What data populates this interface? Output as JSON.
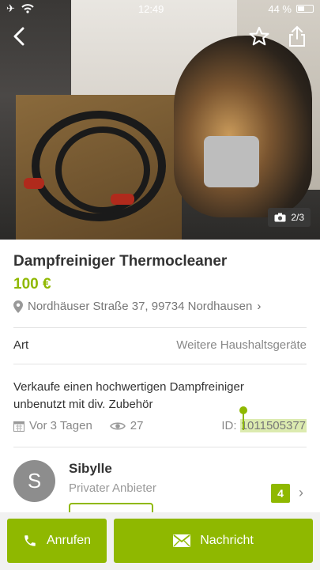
{
  "status_bar": {
    "time": "12:49",
    "battery": "44 %"
  },
  "photo": {
    "counter": "2/3"
  },
  "listing": {
    "title": "Dampfreiniger Thermocleaner",
    "price": "100 €",
    "location": "Nordhäuser Straße 37, 99734 Nordhausen",
    "attribute_key": "Art",
    "attribute_value": "Weitere Haushaltsgeräte",
    "description": "Verkaufe einen hochwertigen Dampfreiniger unbenutzt mit div. Zubehör",
    "posted": "Vor 3 Tagen",
    "views": "27",
    "id_label": "ID:",
    "id_value": "1011505377"
  },
  "seller": {
    "initial": "S",
    "name": "Sibylle",
    "type": "Privater Anbieter",
    "count": "4"
  },
  "actions": {
    "call_label": "Anrufen",
    "message_label": "Nachricht"
  },
  "colors": {
    "accent": "#8fb800"
  }
}
